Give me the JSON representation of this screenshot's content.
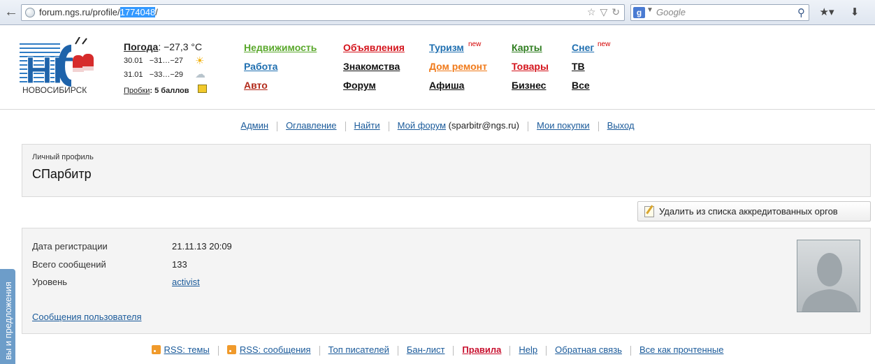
{
  "browser": {
    "url_prefix": "forum.ngs.ru/profile/",
    "url_selected": "1774048",
    "url_suffix": "/",
    "search_placeholder": "Google",
    "back_icon": "back-arrow-icon",
    "star_icon": "bookmark-star-icon"
  },
  "header": {
    "city": "НОВОСИБИРСК",
    "weather": {
      "title": "Погода",
      "now": ": −27,3 °C",
      "day1": "30.01",
      "day1_temp": "−31…−27",
      "day2": "31.01",
      "day2_temp": "−33…−29",
      "traffic_label": "Пробки",
      "traffic_value": ": 5 баллов"
    },
    "menu": [
      {
        "label": "Недвижимость",
        "color": "#5aa82c"
      },
      {
        "label": "Работа",
        "color": "#1f6fb0"
      },
      {
        "label": "Авто",
        "color": "#b22a1a"
      },
      {
        "label": "Объявления",
        "color": "#d4141c"
      },
      {
        "label": "Знакомства",
        "color": "#111111"
      },
      {
        "label": "Форум",
        "color": "#111111"
      },
      {
        "label": "Туризм",
        "color": "#1f6fb0",
        "badge": "new"
      },
      {
        "label": "Дом ремонт",
        "color": "#f07a1a"
      },
      {
        "label": "Афиша",
        "color": "#111111"
      },
      {
        "label": "Карты",
        "color": "#2e7d1f"
      },
      {
        "label": "Товары",
        "color": "#d4141c"
      },
      {
        "label": "Бизнес",
        "color": "#111111"
      },
      {
        "label": "Снег",
        "color": "#1f6fb0",
        "badge": "new"
      },
      {
        "label": "ТВ",
        "color": "#111111"
      },
      {
        "label": "Все",
        "color": "#111111"
      }
    ]
  },
  "toplinks": {
    "admin": "Админ",
    "contents": "Оглавление",
    "find": "Найти",
    "my_forum": "Мой форум",
    "email": " (sparbitr@ngs.ru)",
    "purchases": "Мои покупки",
    "logout": "Выход"
  },
  "profile": {
    "label": "Личный профиль",
    "name": "СПарбитр",
    "remove_button": "Удалить из списка аккредитованных оргов",
    "reg_label": "Дата регистрации",
    "reg_value": "21.11.13 20:09",
    "posts_label": "Всего сообщений",
    "posts_value": "133",
    "level_label": "Уровень",
    "level_value": "activist",
    "user_posts_link": "Сообщения пользователя"
  },
  "side_tab": "вы и предложения",
  "bottomlinks": {
    "rss_topics": "RSS: темы",
    "rss_posts": "RSS: сообщения",
    "top_writers": "Топ писателей",
    "ban_list": "Бан-лист",
    "rules": "Правила",
    "help": "Help",
    "feedback": "Обратная связь",
    "mark_read": "Все как прочтенные"
  }
}
